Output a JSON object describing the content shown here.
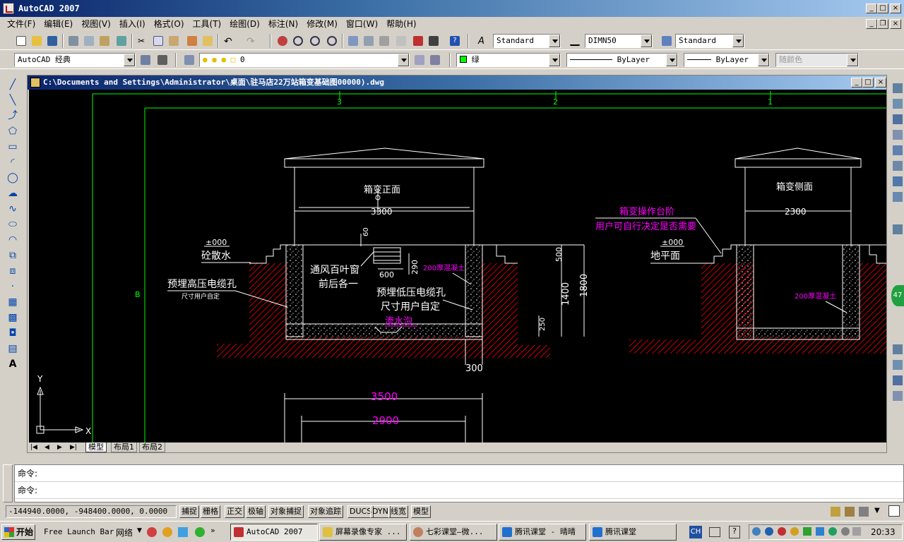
{
  "app": {
    "title": "AutoCAD 2007",
    "window_controls": [
      "_",
      "□",
      "×"
    ]
  },
  "menubar": {
    "items": [
      "文件(F)",
      "编辑(E)",
      "视图(V)",
      "插入(I)",
      "格式(O)",
      "工具(T)",
      "绘图(D)",
      "标注(N)",
      "修改(M)",
      "窗口(W)",
      "帮助(H)"
    ]
  },
  "styles_toolbar": {
    "text_style": "Standard",
    "dim_style": "DIMN50",
    "table_style": "Standard"
  },
  "layers_toolbar": {
    "workspace": "AutoCAD 经典",
    "layer": "0",
    "color": "绿",
    "linetype": "ByLayer",
    "lineweight": "ByLayer",
    "plotstyle": "随颜色"
  },
  "document": {
    "title": "C:\\Documents and Settings\\Administrator\\桌面\\驻马店22万站箱变基础图00000).dwg"
  },
  "drawing": {
    "grid_labels": [
      "3",
      "2",
      "1",
      "B"
    ],
    "front_view_title": "箱变正面",
    "side_view_title": "箱变侧面",
    "dim_3300": "3300",
    "dim_2300": "2300",
    "dim_60": "60",
    "dim_600": "600",
    "dim_290": "290",
    "dim_500": "500",
    "dim_1400": "1400",
    "dim_1800": "1800",
    "dim_250": "250",
    "dim_300": "300",
    "dim_3500": "3500",
    "dim_2900": "2900",
    "level_1": "±000",
    "level_1_label": "砼散水",
    "level_2": "±000",
    "level_2_label": "地平面",
    "label_hv": "预埋高压电缆孔",
    "label_hv_sub": "尺寸用户自定",
    "label_vent1": "通风百叶窗",
    "label_vent2": "前后各一",
    "label_lv1": "预埋低压电缆孔",
    "label_lv2": "尺寸用户自定",
    "label_sump": "渗水沟",
    "label_concrete": "200厚混凝土",
    "label_concrete2": "200厚混凝土",
    "label_step1": "箱变操作台阶",
    "label_step2": "用户可自行决定是否需要",
    "ucs_x": "X",
    "ucs_y": "Y"
  },
  "layout_tabs": [
    "模型",
    "布局1",
    "布局2"
  ],
  "command_lines": [
    "命令:",
    "命令:"
  ],
  "status_bar": {
    "coordinates": "-144940.0000, -948400.0000, 0.0000",
    "buttons": [
      "捕捉",
      "栅格",
      "正交",
      "极轴",
      "对象捕捉",
      "对象追踪",
      "DUCS",
      "DYN",
      "线宽",
      "模型"
    ]
  },
  "taskbar": {
    "start": "开始",
    "quick_launch": "Free Launch Bar",
    "network": "网络",
    "tasks": [
      "AutoCAD 2007",
      "屏幕录像专家 ...",
      "七彩课堂—微...",
      "腾讯课堂 - 晴晴",
      "腾讯课堂"
    ],
    "ime": "CH",
    "clock": "20:33"
  },
  "colors": {
    "canvas_bg": "#000000",
    "drawing_white": "#ffffff",
    "green": "#00ff00",
    "magenta": "#ff00ff",
    "hatch_red": "#ff0000"
  }
}
